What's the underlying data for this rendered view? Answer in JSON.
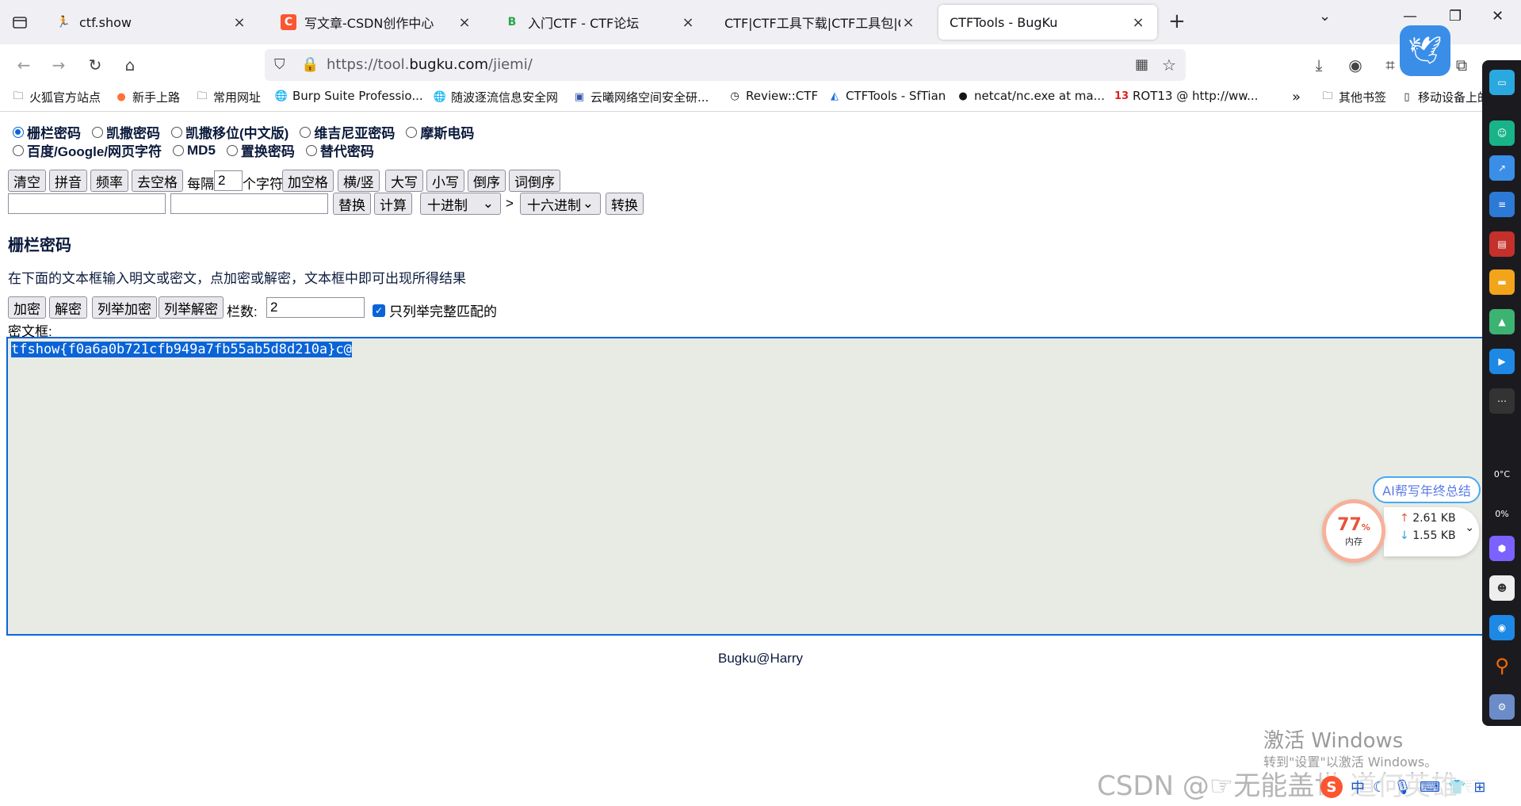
{
  "tabs": [
    {
      "label": "ctf.show",
      "icon": "ctfshow-icon"
    },
    {
      "label": "写文章-CSDN创作中心",
      "icon": "csdn-icon"
    },
    {
      "label": "入门CTF - CTF论坛",
      "icon": "bbs-icon"
    },
    {
      "label": "CTF|CTF工具下载|CTF工具包|CTF彩",
      "icon": "none"
    },
    {
      "label": "CTFTools - BugKu",
      "icon": "none",
      "active": true
    }
  ],
  "address": {
    "prefix": "https://tool.",
    "domain": "bugku.com",
    "path": "/jiemi/"
  },
  "bookmarks": [
    "火狐官方站点",
    "新手上路",
    "常用网址",
    "Burp Suite Professio...",
    "随波逐流信息安全网",
    "云曦网络空间安全研...",
    "Review::CTF",
    "CTFTools - SfTian",
    "netcat/nc.exe at ma...",
    "ROT13 @ http://ww...",
    "其他书签",
    "移动设备上的"
  ],
  "ciphers_row1": [
    {
      "label": "栅栏密码",
      "checked": true
    },
    {
      "label": "凯撒密码",
      "checked": false
    },
    {
      "label": "凯撒移位(中文版)",
      "checked": false
    },
    {
      "label": "维吉尼亚密码",
      "checked": false
    },
    {
      "label": "摩斯电码",
      "checked": false
    }
  ],
  "ciphers_row2": [
    {
      "label": "百度/Google/网页字符",
      "checked": false
    },
    {
      "label": "MD5",
      "checked": false
    },
    {
      "label": "置换密码",
      "checked": false
    },
    {
      "label": "替代密码",
      "checked": false
    }
  ],
  "toolbar": {
    "clear": "清空",
    "pinyin": "拼音",
    "freq": "频率",
    "remove_space": "去空格",
    "every_label": "每隔",
    "every_value": "2",
    "chars_label": "个字符",
    "add_space": "加空格",
    "horiz_vert": "横/竖",
    "upper": "大写",
    "lower": "小写",
    "reverse": "倒序",
    "word_reverse": "词倒序",
    "replace": "替换",
    "calc": "计算",
    "from_base": "十进制",
    "arrow": ">",
    "to_base": "十六进制",
    "convert": "转换"
  },
  "section": {
    "title": "栅栏密码",
    "description": "在下面的文本框输入明文或密文，点加密或解密，文本框中即可出现所得结果",
    "encrypt": "加密",
    "decrypt": "解密",
    "enum_encrypt": "列举加密",
    "enum_decrypt": "列举解密",
    "columns_label": "栏数:",
    "columns_value": "2",
    "only_full_match": "只列举完整匹配的",
    "only_full_match_checked": true,
    "cipher_label": "密文框:",
    "cipher_text": "tfshow{f0a6a0b721cfb949a7fb55ab5d8d210a}c@"
  },
  "footer": "Bugku@Harry",
  "widgets": {
    "ai_pill": "AI帮写年终总结",
    "memory_pct": "77",
    "memory_unit": "%",
    "memory_label": "内存",
    "upload": "2.61 KB",
    "download": "1.55 KB"
  },
  "dock": {
    "temp": "0°C",
    "pct": "0%"
  },
  "system": {
    "activate_title": "激活 Windows",
    "activate_sub": "转到\"设置\"以激活 Windows。",
    "csdn_watermark": "CSDN @☞无能盖世 道何英雄☜",
    "ime": "中"
  },
  "colors": {
    "accent": "#0a64d8",
    "textarea_bg": "#e8ebe4",
    "heading": "#0b1a3c"
  }
}
